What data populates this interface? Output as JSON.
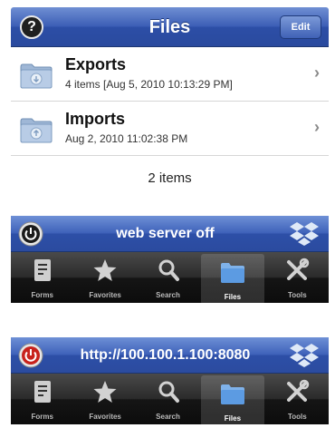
{
  "navbar": {
    "title": "Files",
    "help_label": "?",
    "edit_label": "Edit"
  },
  "files": [
    {
      "name": "Exports",
      "meta": "4 items  [Aug 5, 2010 10:13:29 PM]"
    },
    {
      "name": "Imports",
      "meta": "Aug 2, 2010 11:02:38 PM"
    }
  ],
  "items_count": "2 items",
  "panels": [
    {
      "status": "web server off",
      "power_color": "#1a1a1a",
      "power_state": "off"
    },
    {
      "status": "http://100.100.1.100:8080",
      "power_color": "#c8221c",
      "power_state": "on"
    }
  ],
  "tabs": [
    {
      "label": "Forms",
      "icon": "forms-icon"
    },
    {
      "label": "Favorites",
      "icon": "star-icon"
    },
    {
      "label": "Search",
      "icon": "search-icon"
    },
    {
      "label": "Files",
      "icon": "folder-icon",
      "active": true
    },
    {
      "label": "Tools",
      "icon": "tools-icon"
    }
  ],
  "colors": {
    "nav_blue": "#3d5fb6",
    "tabbar_dark": "#151515",
    "power_on": "#c8221c"
  }
}
